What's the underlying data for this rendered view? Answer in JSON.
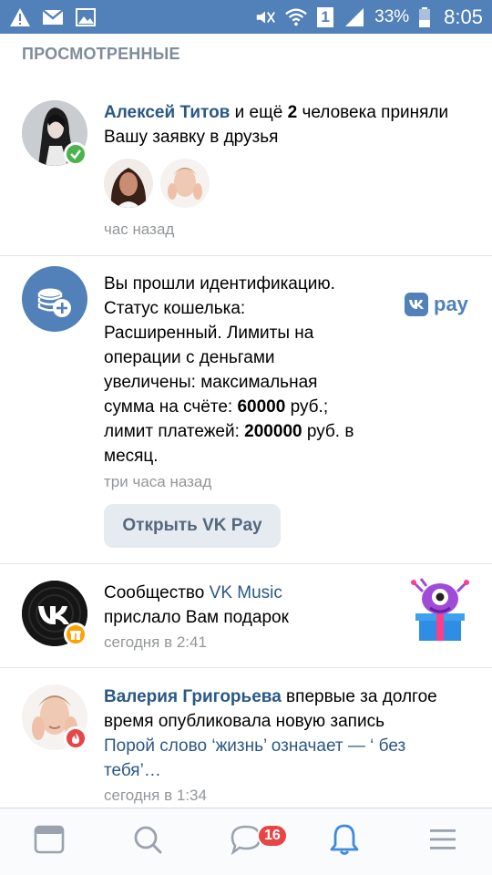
{
  "status_bar": {
    "battery_percent": "33%",
    "time": "8:05",
    "sim_label": "1",
    "icons": [
      "warning-icon",
      "gmail-icon",
      "gallery-icon",
      "mute-icon",
      "wifi-icon",
      "sim-icon",
      "signal-icon",
      "battery-icon"
    ],
    "bg_color": "#5181b8"
  },
  "section": {
    "title": "ПРОСМОТРЕННЫЕ"
  },
  "notifications": [
    {
      "actor": "Алексей Титов",
      "text_a": " и ещё ",
      "count": "2",
      "text_b": " человека приняли Вашу заявку в друзья",
      "time": "час назад",
      "badge_icon": "check-icon",
      "badge_color": "#4bb34b"
    },
    {
      "line1": "Вы прошли идентификацию.",
      "line2": "Статус кошелька:",
      "line3": "Расширенный. Лимиты на",
      "line4": "операции с деньгами",
      "line5": "увеличены: максимальная",
      "line6_a": "сумма на счёте: ",
      "line6_b": "60000",
      "line6_c": " руб.;",
      "line7_a": "лимит платежей: ",
      "line7_b": "200000",
      "line7_c": " руб. в",
      "line8": "месяц.",
      "time": "три часа назад",
      "button_label": "Открыть VK Pay",
      "brand_logo": "VK pay",
      "brand_text": "pay",
      "icon": "coins-plus-icon",
      "icon_color": "#5181b8"
    },
    {
      "prefix": "Сообщество ",
      "community": "VK Music",
      "text": "прислало Вам подарок",
      "time": "сегодня в 2:41",
      "badge_icon": "gift-icon",
      "badge_color": "#ffa000"
    },
    {
      "actor": "Валерия Григорьева",
      "text_a": " впервые за долгое",
      "text_b": "время опубликовала новую запись",
      "quote_1": "Порой слово ‘жизнь’ означает — ‘ без",
      "quote_2": "тебя’…",
      "time": "сегодня в 1:34",
      "badge_icon": "fire-icon",
      "badge_color": "#e64646"
    }
  ],
  "bottom_nav": {
    "items": [
      "feed-icon",
      "search-icon",
      "messages-icon",
      "notifications-icon",
      "menu-icon"
    ],
    "messages_badge": "16",
    "active": "notifications-icon",
    "active_color": "#3f8ae0"
  }
}
